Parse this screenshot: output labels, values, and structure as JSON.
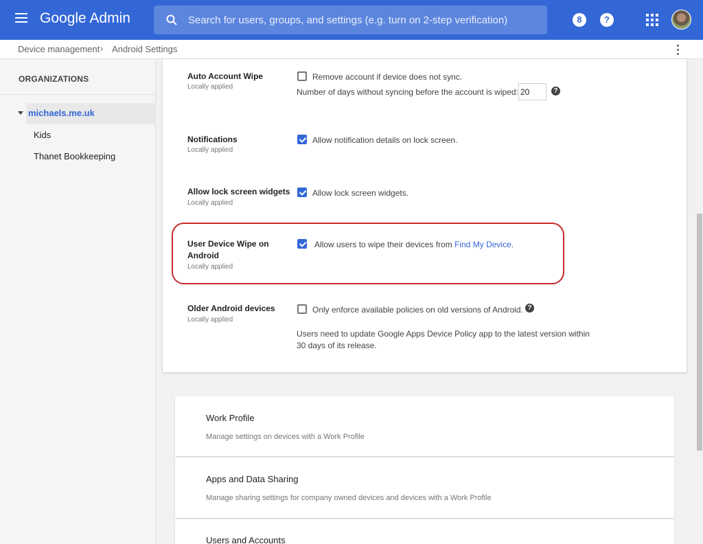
{
  "header": {
    "app_title": "Google Admin",
    "search_placeholder": "Search for users, groups, and settings (e.g. turn on 2-step verification)",
    "icons": [
      "menu-icon",
      "search-icon",
      "support-icon",
      "help-icon",
      "apps-icon",
      "avatar"
    ],
    "brand_color": "#3367d6"
  },
  "breadcrumb": {
    "items": [
      "Device management",
      "Android Settings"
    ],
    "separator": "›"
  },
  "sidebar": {
    "heading": "ORGANIZATIONS",
    "root": "michaels.me.uk",
    "children": [
      "Kids",
      "Thanet Bookkeeping"
    ]
  },
  "settings": [
    {
      "title": "Auto Account Wipe",
      "status": "Locally applied",
      "option": "Remove account if device does not sync.",
      "checked": false,
      "days_label": "Number of days without syncing before the account is wiped:",
      "days_value": "20"
    },
    {
      "title": "Notifications",
      "status": "Locally applied",
      "option": "Allow notification details on lock screen.",
      "checked": true
    },
    {
      "title": "Allow lock screen widgets",
      "status": "Locally applied",
      "option": "Allow lock screen widgets.",
      "checked": true
    },
    {
      "title_line1": "User Device Wipe on",
      "title_line2": "Android",
      "status": "Locally applied",
      "option": "Allow users to wipe their devices from ",
      "option_link": "Find My Device",
      "option_end": ".",
      "checked": true
    },
    {
      "title": "Older Android devices",
      "status": "Locally applied",
      "option": "Only enforce available policies on old versions of Android.",
      "checked": false,
      "note_line1": "Users need to update Google Apps Device Policy app to the latest version within",
      "note_line2": "30 days of its release."
    }
  ],
  "sections": [
    {
      "title": "Work Profile",
      "subtitle": "Manage settings on devices with a Work Profile"
    },
    {
      "title": "Apps and Data Sharing",
      "subtitle": "Manage sharing settings for company owned devices and devices with a Work Profile"
    },
    {
      "title": "Users and Accounts",
      "subtitle": ""
    }
  ],
  "highlight_color": "#c62828"
}
